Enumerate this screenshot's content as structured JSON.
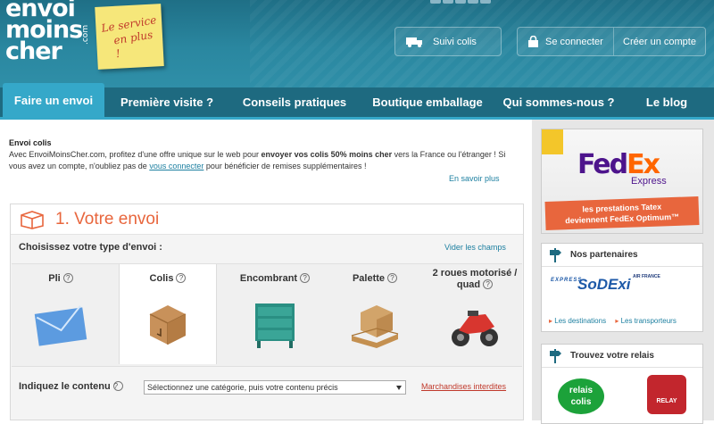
{
  "brand": {
    "logo_line1": "envoi",
    "logo_line2": "moins",
    "logo_line3": "cher",
    "logo_suffix": ".com",
    "note_line1": "Le service",
    "note_line2": "en plus !"
  },
  "header": {
    "suivi_label": "Suivi colis",
    "connect_label": "Se connecter",
    "create_label": "Créer un compte"
  },
  "nav": {
    "items": [
      {
        "label": "Faire un envoi"
      },
      {
        "label": "Première visite ?"
      },
      {
        "label": "Conseils pratiques"
      },
      {
        "label": "Boutique emballage"
      },
      {
        "label": "Qui sommes-nous ?"
      },
      {
        "label": "Le blog"
      }
    ]
  },
  "intro": {
    "title": "Envoi colis",
    "text1": "Avec EnvoiMoinsCher.com, profitez d'une offre unique sur le web pour ",
    "bold": "envoyer vos colis 50% moins cher",
    "text2": " vers la France ou l'étranger ! Si vous avez un compte, n'oubliez pas de ",
    "link": "vous connecter",
    "text3": " pour bénéficier de remises supplémentaires !",
    "more": "En savoir plus"
  },
  "form": {
    "step_title": "1. Votre envoi",
    "type_label": "Choisissez votre type d'envoi :",
    "clear_label": "Vider les champs",
    "help_glyph": "?",
    "types": [
      {
        "label": "Pli",
        "selected": false
      },
      {
        "label": "Colis",
        "selected": true
      },
      {
        "label": "Encombrant",
        "selected": false
      },
      {
        "label": "Palette",
        "selected": false
      },
      {
        "label": "2 roues motorisé / quad",
        "selected": false
      }
    ],
    "content_label": "Indiquez le contenu",
    "content_select": "Sélectionnez une catégorie, puis votre contenu précis",
    "forbidden_link": "Marchandises interdites"
  },
  "sidebar": {
    "fedex_word1": "Fed",
    "fedex_word2": "Ex",
    "fedex_sub": "Express",
    "fedex_banner1": "les prestations Tatex",
    "fedex_banner2": "deviennent FedEx Optimum™",
    "partners_title": "Nos partenaires",
    "partner_name": "SoDExi",
    "partner_tagline": "EXPRESS",
    "partner_af": "AIR FRANCE",
    "partner_links": [
      "Les destinations",
      "Les transporteurs"
    ],
    "relay_title": "Trouvez votre relais",
    "relay1_line1": "relais",
    "relay1_line2": "colis",
    "relay2": "RELAY"
  },
  "colors": {
    "header_bg": "#2a87a0",
    "nav_active": "#35a8c9",
    "accent_orange": "#e8663d",
    "link_blue": "#1c7fa0"
  }
}
